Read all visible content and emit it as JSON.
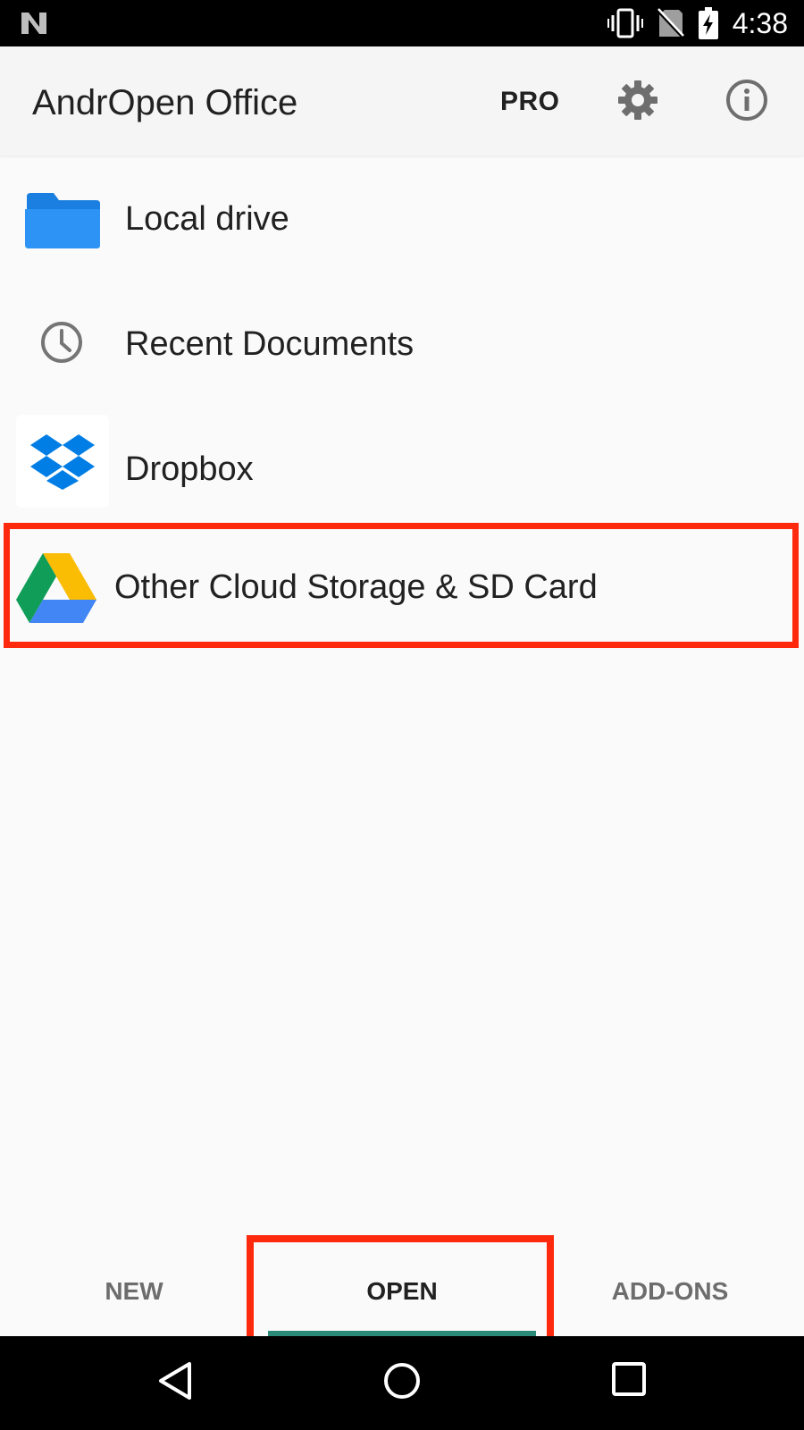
{
  "status_bar": {
    "time": "4:38",
    "icons": [
      "n-logo-icon",
      "vibrate-icon",
      "no-sim-icon",
      "battery-charging-icon"
    ]
  },
  "app_bar": {
    "title": "AndrOpen Office",
    "pro_label": "PRO",
    "icons": [
      "settings-icon",
      "info-icon"
    ]
  },
  "list": {
    "items": [
      {
        "label": "Local drive",
        "icon": "folder-icon"
      },
      {
        "label": "Recent Documents",
        "icon": "clock-icon"
      },
      {
        "label": "Dropbox",
        "icon": "dropbox-icon"
      },
      {
        "label": "Other Cloud Storage & SD Card",
        "icon": "google-drive-icon"
      }
    ]
  },
  "tabs": [
    {
      "label": "NEW",
      "selected": false
    },
    {
      "label": "OPEN",
      "selected": true
    },
    {
      "label": "ADD-ONS",
      "selected": false
    }
  ],
  "colors": {
    "tab_indicator": "#2b8a78",
    "highlight": "#ff2a0d",
    "folder": "#2196f3"
  },
  "nav_bar": {
    "icons": [
      "back-icon",
      "home-icon",
      "recents-icon"
    ]
  }
}
